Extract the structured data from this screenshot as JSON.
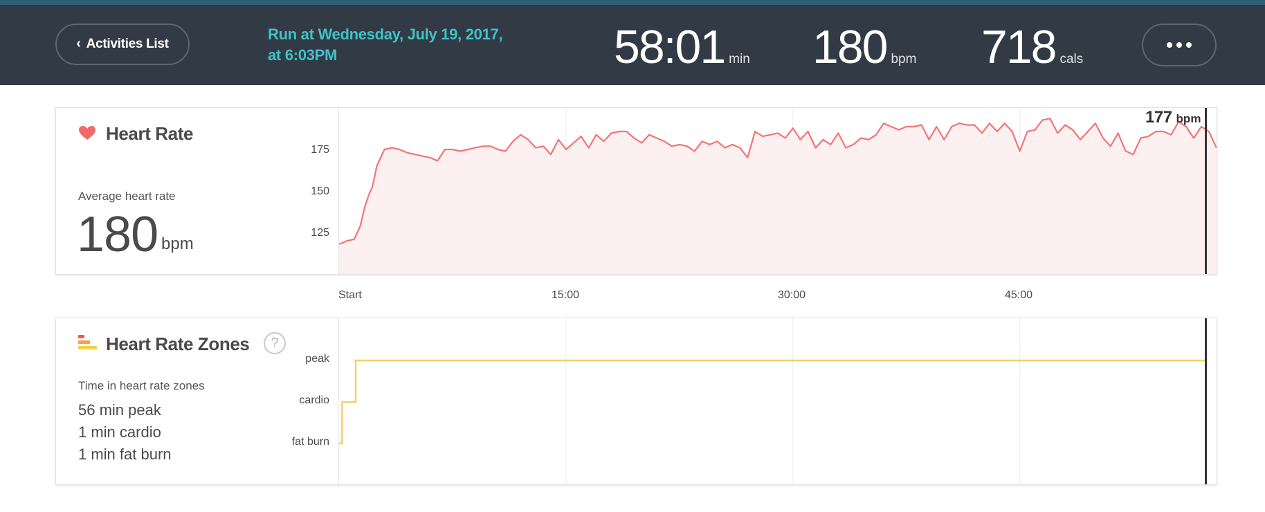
{
  "header": {
    "back_label": "Activities List",
    "title_line1": "Run at Wednesday, July 19, 2017,",
    "title_line2": "at 6:03PM",
    "stats": [
      {
        "value": "58:01",
        "unit": "min"
      },
      {
        "value": "180",
        "unit": "bpm"
      },
      {
        "value": "718",
        "unit": "cals"
      }
    ]
  },
  "heart_rate": {
    "title": "Heart Rate",
    "avg_label": "Average heart rate",
    "avg_value": "180",
    "avg_unit": "bpm",
    "cursor_value": "177",
    "cursor_unit": "bpm"
  },
  "zones": {
    "title": "Heart Rate Zones",
    "help": "?",
    "subtitle": "Time in heart rate zones",
    "lines": [
      "56 min peak",
      "1 min cardio",
      "1 min fat burn"
    ]
  },
  "colors": {
    "header_bg": "#323a45",
    "accent": "#3fc3c7",
    "hr_line": "#f47474",
    "hr_fill": "#fdf0f0",
    "zone_line": "#f2d06a",
    "heart_icon": "#f16a6a"
  },
  "chart_data": [
    {
      "type": "area",
      "title": "Heart Rate",
      "x_unit": "min",
      "x_ticks": [
        {
          "x": 0,
          "label": "Start"
        },
        {
          "x": 15,
          "label": "15:00"
        },
        {
          "x": 30,
          "label": "30:00"
        },
        {
          "x": 45,
          "label": "45:00"
        }
      ],
      "y_ticks": [
        125,
        150,
        175
      ],
      "ylim": [
        110,
        200
      ],
      "xlim": [
        0,
        58.1
      ],
      "grid": true,
      "series": [
        {
          "x": [
            0,
            0.5,
            1,
            1.4,
            1.7,
            2.0,
            2.2,
            2.5,
            3.0,
            3.5,
            4.0,
            4.5,
            5,
            5.5,
            6,
            6.5,
            7,
            7.5,
            8,
            8.5,
            9,
            9.5,
            10,
            10.5,
            11,
            11.5,
            12,
            12.5,
            13,
            13.5,
            14,
            14.5,
            15,
            15.5,
            16,
            16.5,
            17,
            17.5,
            18,
            18.5,
            19,
            19.5,
            20,
            20.5,
            21,
            21.5,
            22,
            22.5,
            23,
            23.5,
            24,
            24.5,
            25,
            25.5,
            26,
            26.5,
            27,
            27.5,
            28,
            28.5,
            29,
            29.5,
            30,
            30.5,
            31,
            31.5,
            32,
            32.5,
            33,
            33.5,
            34,
            34.5,
            35,
            35.5,
            36,
            36.5,
            37,
            37.5,
            38,
            38.5,
            39,
            39.5,
            40,
            40.5,
            41,
            41.5,
            42,
            42.5,
            43,
            43.5,
            44,
            44.5,
            45,
            45.5,
            46,
            46.5,
            47,
            47.5,
            48,
            48.5,
            49,
            49.5,
            50,
            50.5,
            51,
            51.5,
            52,
            52.5,
            53,
            53.5,
            54,
            54.5,
            55,
            55.5,
            56,
            56.5,
            57,
            57.5,
            58
          ],
          "y": [
            117,
            119,
            120,
            128,
            140,
            148,
            152,
            165,
            175,
            176,
            175,
            173,
            172,
            171,
            170,
            168,
            175,
            175,
            174,
            175,
            176,
            177,
            177,
            175,
            174,
            180,
            184,
            181,
            176,
            177,
            172,
            181,
            175,
            179,
            183,
            176,
            184,
            180,
            185,
            186,
            186,
            182,
            179,
            184,
            182,
            180,
            177,
            178,
            177,
            174,
            180,
            178,
            180,
            176,
            178,
            176,
            170,
            186,
            183,
            184,
            185,
            182,
            188,
            181,
            186,
            176,
            181,
            178,
            185,
            176,
            178,
            182,
            181,
            184,
            191,
            189,
            187,
            189,
            189,
            190,
            181,
            189,
            181,
            189,
            191,
            190,
            190,
            185,
            191,
            186,
            191,
            186,
            174,
            186,
            187,
            193,
            194,
            185,
            190,
            187,
            181,
            186,
            191,
            182,
            177,
            185,
            174,
            172,
            182,
            183,
            186,
            186,
            184,
            192,
            189,
            182,
            189,
            186,
            176
          ]
        }
      ],
      "annotations": [
        {
          "x": 57.3,
          "label": "177 bpm"
        }
      ]
    },
    {
      "type": "line",
      "title": "Heart Rate Zones",
      "x_unit": "min",
      "xlim": [
        0,
        58.1
      ],
      "categories_y": [
        "fat burn",
        "cardio",
        "peak"
      ],
      "series": [
        {
          "x": [
            0,
            0.2,
            0.2,
            1.1,
            1.1,
            57.3
          ],
          "y": [
            "fat burn",
            "fat burn",
            "cardio",
            "cardio",
            "peak",
            "peak"
          ]
        }
      ]
    }
  ]
}
